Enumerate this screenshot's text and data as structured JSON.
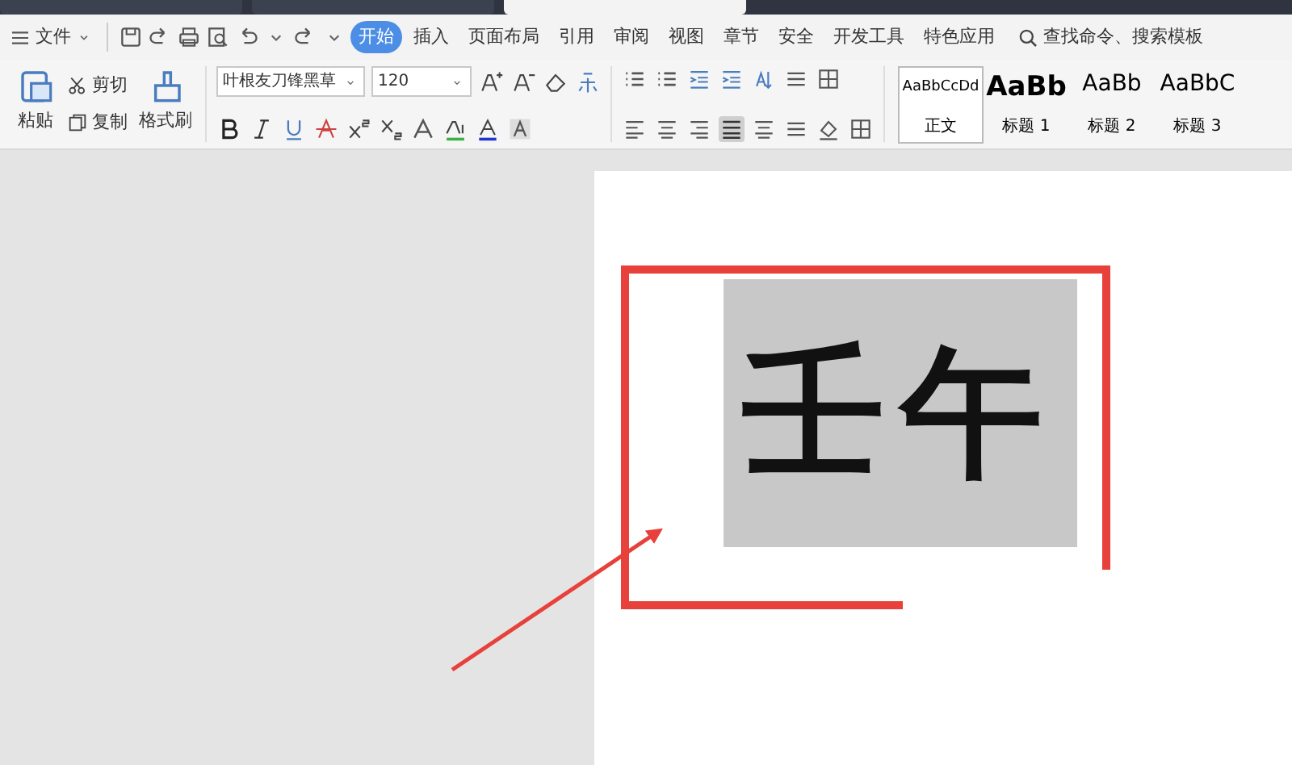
{
  "window_tabs": [
    {
      "selected": false
    },
    {
      "selected": false
    },
    {
      "selected": true
    }
  ],
  "menu": {
    "file_label": "文件",
    "ribbon_tabs": [
      {
        "label": "开始",
        "selected": true
      },
      {
        "label": "插入",
        "selected": false
      },
      {
        "label": "页面布局",
        "selected": false
      },
      {
        "label": "引用",
        "selected": false
      },
      {
        "label": "审阅",
        "selected": false
      },
      {
        "label": "视图",
        "selected": false
      },
      {
        "label": "章节",
        "selected": false
      },
      {
        "label": "安全",
        "selected": false
      },
      {
        "label": "开发工具",
        "selected": false
      },
      {
        "label": "特色应用",
        "selected": false
      }
    ],
    "search": "查找命令、搜索模板"
  },
  "clipboard": {
    "paste": "粘贴",
    "cut": "剪切",
    "copy": "复制",
    "format_painter": "格式刷"
  },
  "font": {
    "name": "叶根友刀锋黑草",
    "size": "120"
  },
  "styles": [
    {
      "preview": "AaBbCcDd",
      "label": "正文",
      "selected": true
    },
    {
      "preview": "AaBb",
      "label": "标题 1",
      "selected": false
    },
    {
      "preview": "AaBb",
      "label": "标题 2",
      "selected": false
    },
    {
      "preview": "AaBbC",
      "label": "标题 3",
      "selected": false
    }
  ],
  "document": {
    "text": "壬午",
    "highlighted": true
  }
}
